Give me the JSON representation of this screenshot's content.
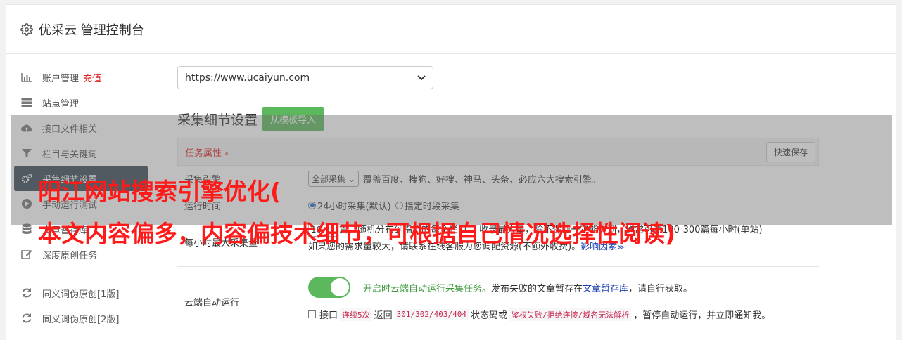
{
  "header": {
    "title": "优采云 管理控制台",
    "icon": "gear-icon"
  },
  "sidebar": {
    "items": [
      {
        "label": "账户管理",
        "badge": "充值",
        "icon": "bar-chart-icon"
      },
      {
        "label": "站点管理",
        "icon": "server-icon"
      },
      {
        "label": "接口文件相关",
        "icon": "cloud-upload-icon"
      },
      {
        "label": "栏目与关键词",
        "icon": "filter-icon"
      },
      {
        "label": "采集细节设置",
        "icon": "gears-icon",
        "active": true
      },
      {
        "label": "手动运行测试",
        "icon": "play-circle-icon"
      },
      {
        "label": "文章暂存库",
        "icon": "database-icon"
      },
      {
        "label": "深度原创任务",
        "icon": "edit-icon"
      },
      {
        "label": "同义词伪原创[1版]",
        "icon": "refresh-icon"
      },
      {
        "label": "同义词伪原创[2版]",
        "icon": "refresh-icon"
      }
    ]
  },
  "main": {
    "site_select": "https://www.ucaiyun.com",
    "section_title": "采集细节设置",
    "import_button": "从模板导入",
    "attr_label": "任务属性",
    "attr_chevron": "»",
    "quick_save": "快速保存",
    "rows": {
      "engine": {
        "key": "采集引擎",
        "select": "全部采集",
        "desc": "覆盖百度、搜狗、好搜、神马、头条、必应六大搜索引擎。"
      },
      "runtime": {
        "key": "运行时间",
        "opt1": "24小时采集(默认)",
        "opt2": "指定时段采集"
      },
      "max": {
        "key": "每小时最大采集量",
        "value": "10",
        "line1": "篇，随机分布到指定的每个栏目。 收录最大量，除不保证一定能达到，通常可达100-300篇每小时(单站)",
        "line2": "如果您的需求量较大，请联系在线客服为您调配资源(不额外收费)。",
        "link": "影响因素"
      },
      "cloud": {
        "key": "云端自动运行",
        "green": "开启时云端自动运行采集任务。",
        "text1": "发布失败的文章暂存在",
        "link": "文章暂存库",
        "text2": "，请自行获取。",
        "l2_prefix": "接口",
        "code1": "连续5次",
        "l2_mid1": "返回",
        "code2": "301/302/403/404",
        "l2_mid2": "状态码或",
        "code3": "鉴权失败/拒绝连接/域名无法解析",
        "l2_tail": "，暂停自动运行，并立即通知我。"
      }
    }
  },
  "overlay": {
    "line1": "阳江网站搜索引擎优化(",
    "line2": "本文内容偏多，内容偏技术细节，可根据自己情况选择性阅读)"
  },
  "colors": {
    "active_bg": "#3a4756",
    "green": "#5cb85c",
    "red": "#e02020",
    "link": "#1a3fb0"
  }
}
